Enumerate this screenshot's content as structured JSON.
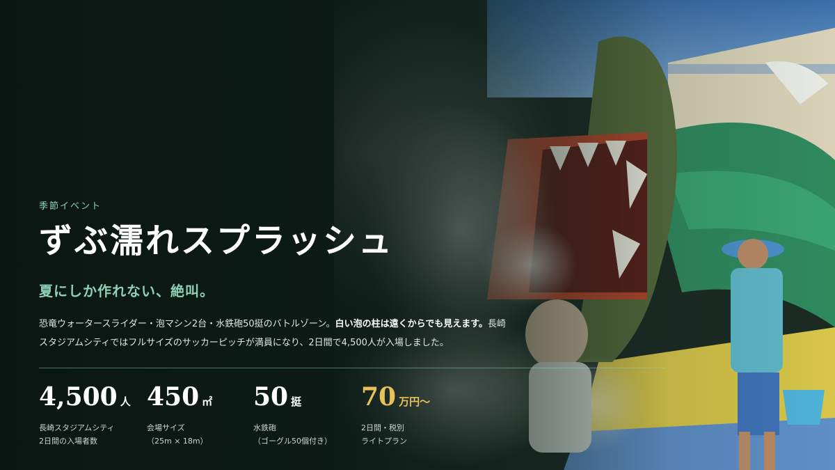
{
  "hero": {
    "eyebrow": "季節イベント",
    "title": "ずぶ濡れスプラッシュ",
    "subtitle": "夏にしか作れない、絶叫。",
    "description": {
      "part1": "恐竜ウォータースライダー・泡マシン2台・水鉄砲50挺のバトルゾーン。",
      "highlight": "白い泡の柱は遠くからでも見えます。",
      "part2": "長崎スタジアムシティではフルサイズのサッカーピッチが満員になり、2日間で4,500人が入場しました。"
    }
  },
  "stats": [
    {
      "value": "4,500",
      "unit": "人",
      "label1": "長崎スタジアムシティ",
      "label2": "2日間の入場者数"
    },
    {
      "value": "450",
      "unit": "㎡",
      "label1": "会場サイズ",
      "label2": "（25m × 18m）"
    },
    {
      "value": "50",
      "unit": "挺",
      "label1": "水鉄砲",
      "label2": "（ゴーグル50個付き）"
    },
    {
      "value": "70",
      "unit": "万円〜",
      "label1": "2日間・税別",
      "label2": "ライトプラン"
    }
  ],
  "colors": {
    "accent": "#8fd1b5",
    "highlight_gold": "#e8c15a",
    "background": "#0d1512"
  }
}
